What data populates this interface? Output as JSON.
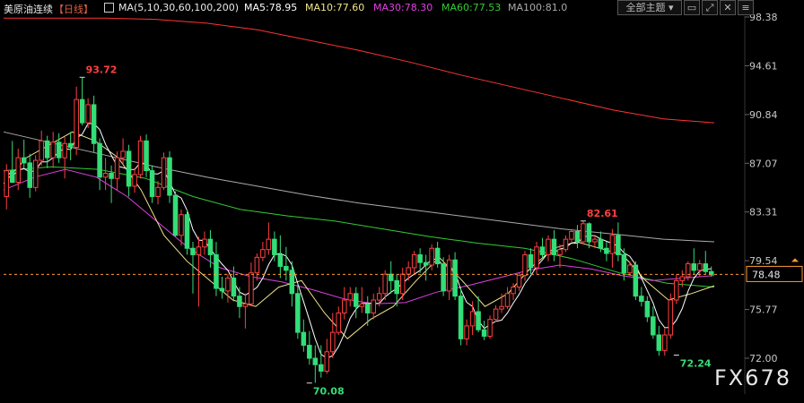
{
  "header": {
    "symbol": "美原油连续",
    "period": "【日线】",
    "ma_params": "MA(5,10,30,60,100,200)",
    "ma5": "MA5:78.95",
    "ma10": "MA10:77.60",
    "ma30": "MA30:78.30",
    "ma60": "MA60:77.53",
    "ma100": "MA100:81.0",
    "theme_button": "全部主题",
    "colors": {
      "ma5": "#ffffff",
      "ma10": "#f0e68c",
      "ma30": "#e040e0",
      "ma60": "#33cc33",
      "ma100": "#aaaaaa",
      "ma200": "#ff3333"
    }
  },
  "watermark": "FX678",
  "chart_data": {
    "type": "candlestick",
    "y_ticks": [
      "98.38",
      "94.61",
      "90.84",
      "87.07",
      "83.31",
      "79.54",
      "75.77",
      "72.00"
    ],
    "ylim": [
      70.9,
      99.0
    ],
    "current_price": "78.48",
    "up_color": "#ff4040",
    "down_color": "#33dd77",
    "annotations": [
      {
        "text": "93.72",
        "index": 13,
        "value": 93.72,
        "color": "#ff4040"
      },
      {
        "text": "82.61",
        "index": 99,
        "value": 82.61,
        "color": "#ff4040"
      },
      {
        "text": "70.08",
        "index": 52,
        "value": 70.08,
        "color": "#33dd77"
      },
      {
        "text": "72.24",
        "index": 115,
        "value": 72.24,
        "color": "#33dd77"
      }
    ],
    "candles": [
      [
        84.5,
        87.0,
        83.5,
        86.5
      ],
      [
        86.5,
        88.8,
        85.8,
        85.6
      ],
      [
        85.6,
        88.2,
        85.0,
        87.5
      ],
      [
        87.5,
        88.9,
        86.7,
        87.1
      ],
      [
        87.1,
        87.8,
        84.4,
        85.2
      ],
      [
        85.2,
        87.7,
        84.9,
        87.3
      ],
      [
        87.3,
        89.6,
        86.9,
        88.8
      ],
      [
        88.8,
        89.2,
        86.7,
        87.5
      ],
      [
        87.5,
        89.5,
        86.7,
        88.7
      ],
      [
        88.7,
        89.4,
        87.1,
        87.5
      ],
      [
        87.5,
        89.1,
        85.9,
        88.6
      ],
      [
        88.6,
        89.5,
        87.3,
        88.3
      ],
      [
        88.3,
        93.0,
        87.7,
        92.0
      ],
      [
        92.0,
        93.7,
        90.0,
        90.2
      ],
      [
        90.2,
        92.1,
        89.8,
        91.6
      ],
      [
        91.6,
        92.3,
        87.9,
        88.6
      ],
      [
        88.6,
        89.0,
        85.0,
        86.0
      ],
      [
        86.0,
        87.5,
        85.0,
        86.3
      ],
      [
        86.3,
        86.9,
        84.0,
        85.9
      ],
      [
        85.9,
        88.0,
        85.0,
        87.5
      ],
      [
        87.5,
        89.0,
        87.0,
        88.0
      ],
      [
        88.0,
        88.5,
        84.5,
        85.3
      ],
      [
        85.3,
        86.7,
        84.8,
        86.2
      ],
      [
        86.2,
        89.2,
        85.9,
        88.8
      ],
      [
        88.8,
        89.3,
        86.0,
        86.5
      ],
      [
        86.5,
        86.9,
        84.0,
        84.5
      ],
      [
        84.5,
        85.7,
        83.9,
        85.2
      ],
      [
        85.2,
        87.9,
        85.0,
        87.5
      ],
      [
        87.5,
        88.0,
        84.0,
        84.6
      ],
      [
        84.6,
        84.9,
        81.4,
        81.5
      ],
      [
        81.5,
        83.5,
        80.7,
        83.1
      ],
      [
        83.1,
        83.5,
        80.0,
        80.5
      ],
      [
        80.5,
        81.0,
        77.0,
        80.0
      ],
      [
        80.0,
        81.4,
        76.0,
        80.6
      ],
      [
        80.6,
        81.8,
        80.0,
        81.2
      ],
      [
        81.2,
        81.9,
        79.0,
        80.0
      ],
      [
        80.0,
        81.0,
        76.8,
        77.4
      ],
      [
        77.4,
        78.3,
        76.6,
        77.2
      ],
      [
        77.2,
        78.5,
        76.3,
        78.2
      ],
      [
        78.2,
        79.1,
        76.4,
        76.8
      ],
      [
        76.8,
        77.5,
        75.1,
        76.0
      ],
      [
        76.0,
        77.0,
        74.3,
        76.2
      ],
      [
        76.2,
        79.4,
        76.0,
        78.6
      ],
      [
        78.6,
        80.1,
        78.0,
        79.8
      ],
      [
        79.8,
        81.0,
        79.5,
        80.4
      ],
      [
        80.4,
        82.5,
        80.0,
        81.2
      ],
      [
        81.2,
        81.8,
        79.5,
        80.0
      ],
      [
        80.0,
        81.5,
        78.2,
        79.1
      ],
      [
        79.1,
        80.6,
        78.0,
        78.8
      ],
      [
        78.8,
        79.5,
        76.0,
        77.0
      ],
      [
        77.0,
        77.8,
        73.5,
        74.0
      ],
      [
        74.0,
        75.0,
        72.5,
        73.0
      ],
      [
        73.0,
        74.1,
        71.5,
        72.0
      ],
      [
        72.0,
        73.0,
        70.1,
        71.5
      ],
      [
        71.5,
        73.0,
        70.5,
        71.0
      ],
      [
        71.0,
        73.5,
        70.8,
        72.5
      ],
      [
        72.5,
        75.5,
        72.0,
        74.0
      ],
      [
        74.0,
        76.0,
        73.8,
        75.5
      ],
      [
        75.5,
        77.5,
        75.0,
        76.5
      ],
      [
        76.5,
        77.5,
        76.0,
        77.0
      ],
      [
        77.0,
        77.5,
        75.1,
        76.0
      ],
      [
        76.0,
        77.5,
        75.5,
        76.2
      ],
      [
        76.2,
        76.8,
        74.5,
        75.5
      ],
      [
        75.5,
        77.0,
        75.0,
        76.5
      ],
      [
        76.5,
        77.5,
        76.0,
        77.0
      ],
      [
        77.0,
        78.8,
        76.5,
        78.5
      ],
      [
        78.5,
        79.5,
        77.0,
        78.0
      ],
      [
        78.0,
        78.5,
        76.0,
        77.0
      ],
      [
        77.0,
        79.0,
        76.5,
        78.5
      ],
      [
        78.5,
        79.5,
        78.0,
        79.0
      ],
      [
        79.0,
        80.3,
        78.5,
        80.0
      ],
      [
        80.0,
        80.5,
        78.6,
        79.4
      ],
      [
        79.4,
        80.0,
        78.0,
        79.2
      ],
      [
        79.2,
        80.8,
        78.8,
        80.5
      ],
      [
        80.5,
        81.0,
        79.0,
        79.3
      ],
      [
        79.3,
        79.8,
        76.8,
        77.2
      ],
      [
        77.2,
        80.0,
        76.5,
        79.6
      ],
      [
        79.6,
        80.2,
        76.5,
        76.8
      ],
      [
        76.8,
        77.5,
        73.0,
        73.5
      ],
      [
        73.5,
        75.0,
        73.0,
        74.5
      ],
      [
        74.5,
        76.4,
        73.8,
        75.6
      ],
      [
        75.6,
        76.8,
        74.0,
        74.2
      ],
      [
        74.2,
        74.9,
        73.4,
        73.7
      ],
      [
        73.7,
        75.3,
        73.5,
        75.0
      ],
      [
        75.0,
        76.1,
        74.8,
        75.8
      ],
      [
        75.8,
        77.0,
        75.5,
        76.0
      ],
      [
        76.0,
        77.5,
        75.8,
        77.0
      ],
      [
        77.0,
        77.8,
        76.5,
        77.5
      ],
      [
        77.5,
        78.6,
        77.2,
        78.4
      ],
      [
        78.4,
        80.3,
        78.0,
        80.0
      ],
      [
        80.0,
        80.5,
        78.5,
        79.0
      ],
      [
        79.0,
        81.0,
        78.5,
        80.6
      ],
      [
        80.6,
        81.3,
        79.8,
        80.0
      ],
      [
        80.0,
        81.5,
        79.5,
        81.2
      ],
      [
        81.2,
        81.9,
        79.5,
        80.0
      ],
      [
        80.0,
        80.8,
        79.0,
        80.4
      ],
      [
        80.4,
        81.5,
        80.2,
        81.2
      ],
      [
        81.2,
        82.0,
        81.0,
        81.8
      ],
      [
        81.8,
        82.3,
        80.5,
        81.0
      ],
      [
        81.0,
        82.6,
        80.8,
        82.4
      ],
      [
        82.4,
        82.5,
        80.5,
        81.0
      ],
      [
        81.0,
        81.5,
        80.5,
        81.2
      ],
      [
        81.2,
        81.8,
        80.2,
        80.5
      ],
      [
        80.5,
        81.0,
        79.5,
        80.1
      ],
      [
        80.1,
        82.0,
        79.0,
        81.5
      ],
      [
        81.5,
        82.5,
        79.5,
        80.0
      ],
      [
        80.0,
        80.5,
        78.0,
        78.6
      ],
      [
        78.6,
        79.5,
        78.5,
        79.2
      ],
      [
        79.2,
        79.5,
        76.5,
        76.8
      ],
      [
        76.8,
        77.5,
        76.0,
        76.4
      ],
      [
        76.4,
        76.8,
        74.8,
        75.2
      ],
      [
        75.2,
        76.0,
        73.5,
        73.8
      ],
      [
        73.8,
        74.5,
        72.2,
        72.6
      ],
      [
        72.6,
        74.3,
        72.2,
        73.8
      ],
      [
        73.8,
        77.0,
        73.5,
        76.5
      ],
      [
        76.5,
        78.5,
        76.2,
        78.0
      ],
      [
        78.0,
        78.8,
        77.5,
        78.3
      ],
      [
        78.3,
        79.5,
        78.0,
        79.3
      ],
      [
        79.3,
        80.5,
        78.5,
        78.8
      ],
      [
        78.8,
        79.6,
        78.3,
        79.3
      ],
      [
        79.3,
        80.3,
        78.5,
        78.7
      ],
      [
        78.7,
        79.1,
        78.3,
        78.48
      ]
    ],
    "ma200": [
      98.3,
      98.3,
      98.3,
      98.2,
      97.9,
      97.4,
      96.6,
      95.8,
      94.9,
      93.9,
      93.0,
      92.1,
      91.2,
      90.5,
      90.2
    ],
    "ma100": [
      89.5,
      88.6,
      87.7,
      86.8,
      86.0,
      85.3,
      84.6,
      84.0,
      83.5,
      83.0,
      82.5,
      82.0,
      81.6,
      81.2,
      81.0
    ],
    "ma60": [
      86.5,
      86.8,
      86.6,
      85.9,
      84.5,
      83.5,
      83.0,
      82.6,
      82.0,
      81.4,
      80.9,
      80.5,
      79.7,
      78.6,
      77.8,
      77.5
    ],
    "ma30": [
      85.0,
      86.0,
      86.6,
      86.0,
      84.5,
      82.5,
      80.5,
      79.0,
      78.3,
      77.9,
      77.3,
      76.6,
      76.2,
      76.3,
      77.1,
      77.6,
      78.2,
      78.8,
      79.2,
      78.9,
      78.4,
      78.0,
      78.2,
      78.4
    ],
    "ma10": [
      85.5,
      87.5,
      88.5,
      89.5,
      88.8,
      87.5,
      85.0,
      81.5,
      79.5,
      78.0,
      76.5,
      76.0,
      77.5,
      78.0,
      75.5,
      73.5,
      75.0,
      76.0,
      78.0,
      79.8,
      78.0,
      76.0,
      77.0,
      79.0,
      80.5,
      81.0,
      80.5,
      80.0,
      78.0,
      76.5,
      77.0,
      77.6
    ]
  }
}
